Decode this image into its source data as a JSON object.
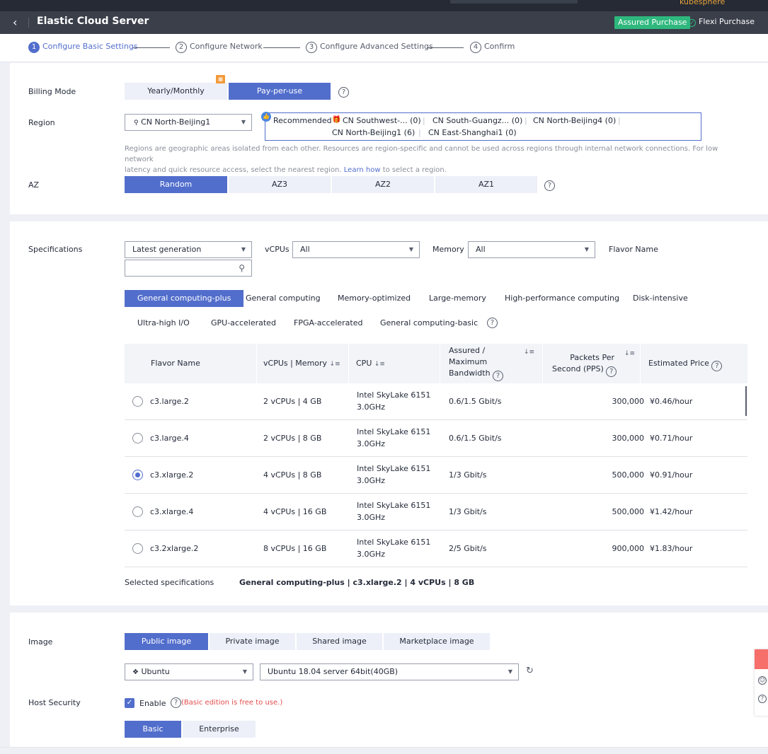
{
  "topbar": {
    "user": "kubesphere"
  },
  "header": {
    "back_icon": "chevron-left-icon",
    "title": "Elastic Cloud Server",
    "assured_purchase": "Assured Purchase",
    "flexi_purchase": "Flexi Purchase"
  },
  "steps": [
    {
      "num": "1",
      "label": "Configure Basic Settings"
    },
    {
      "num": "2",
      "label": "Configure Network"
    },
    {
      "num": "3",
      "label": "Configure Advanced Settings"
    },
    {
      "num": "4",
      "label": "Confirm"
    }
  ],
  "billing": {
    "label": "Billing Mode",
    "options": [
      "Yearly/Monthly",
      "Pay-per-use"
    ],
    "selected": "Pay-per-use",
    "help": "?"
  },
  "region": {
    "label": "Region",
    "selected": "CN North-Beijing1",
    "recommended_label": "Recommended",
    "recommended": [
      "CN Southwest-... (0)",
      "CN South-Guangz... (0)",
      "CN North-Beijing4 (0)",
      "CN North-Beijing1 (6)",
      "CN East-Shanghai1 (0)"
    ],
    "note_1": "Regions are geographic areas isolated from each other. Resources are region-specific and cannot be used across regions through internal network connections. For low network",
    "note_2a": "latency and quick resource access, select the nearest region.",
    "note_link": "Learn how",
    "note_2b": "to select a region."
  },
  "az": {
    "label": "AZ",
    "options": [
      "Random",
      "AZ3",
      "AZ2",
      "AZ1"
    ],
    "selected": "Random",
    "help": "?"
  },
  "specs": {
    "label": "Specifications",
    "generation": "Latest generation",
    "vcpus_label": "vCPUs",
    "vcpus_value": "All",
    "memory_label": "Memory",
    "memory_value": "All",
    "flavor_name_label": "Flavor Name",
    "flavor_search_value": "",
    "categories_row1": [
      "General computing-plus",
      "General computing",
      "Memory-optimized",
      "Large-memory",
      "High-performance computing",
      "Disk-intensive"
    ],
    "categories_row2": [
      "Ultra-high I/O",
      "GPU-accelerated",
      "FPGA-accelerated",
      "General computing-basic"
    ],
    "selected_category": "General computing-plus",
    "help": "?"
  },
  "table": {
    "headers": {
      "flavor": "Flavor Name",
      "vcpus_mem": "vCPUs | Memory",
      "cpu": "CPU",
      "bw_1": "Assured /",
      "bw_2": "Maximum",
      "bw_3": "Bandwidth",
      "pps_1": "Packets Per",
      "pps_2": "Second (PPS)",
      "price": "Estimated Price"
    },
    "sort_icon": "sort-icon",
    "rows": [
      {
        "flavor": "c3.large.2",
        "vcpus_mem": "2 vCPUs | 4 GB",
        "cpu_1": "Intel SkyLake 6151",
        "cpu_2": "3.0GHz",
        "bandwidth": "0.6/1.5 Gbit/s",
        "pps": "300,000",
        "price": "¥0.46/hour",
        "selected": false
      },
      {
        "flavor": "c3.large.4",
        "vcpus_mem": "2 vCPUs | 8 GB",
        "cpu_1": "Intel SkyLake 6151",
        "cpu_2": "3.0GHz",
        "bandwidth": "0.6/1.5 Gbit/s",
        "pps": "300,000",
        "price": "¥0.71/hour",
        "selected": false
      },
      {
        "flavor": "c3.xlarge.2",
        "vcpus_mem": "4 vCPUs | 8 GB",
        "cpu_1": "Intel SkyLake 6151",
        "cpu_2": "3.0GHz",
        "bandwidth": "1/3 Gbit/s",
        "pps": "500,000",
        "price": "¥0.91/hour",
        "selected": true
      },
      {
        "flavor": "c3.xlarge.4",
        "vcpus_mem": "4 vCPUs | 16 GB",
        "cpu_1": "Intel SkyLake 6151",
        "cpu_2": "3.0GHz",
        "bandwidth": "1/3 Gbit/s",
        "pps": "500,000",
        "price": "¥1.42/hour",
        "selected": false
      },
      {
        "flavor": "c3.2xlarge.2",
        "vcpus_mem": "8 vCPUs | 16 GB",
        "cpu_1": "Intel SkyLake 6151",
        "cpu_2": "3.0GHz",
        "bandwidth": "2/5 Gbit/s",
        "pps": "900,000",
        "price": "¥1.83/hour",
        "selected": false
      }
    ],
    "selected_label": "Selected specifications",
    "selected_value": "General computing-plus | c3.xlarge.2 | 4 vCPUs | 8 GB"
  },
  "image": {
    "label": "Image",
    "options": [
      "Public image",
      "Private image",
      "Shared image",
      "Marketplace image"
    ],
    "selected": "Public image",
    "os": "Ubuntu",
    "version": "Ubuntu 18.04 server 64bit(40GB)"
  },
  "host_security": {
    "label": "Host Security",
    "enable_label": "Enable",
    "note": "(Basic edition is free to use.)",
    "editions": [
      "Basic",
      "Enterprise"
    ],
    "selected": "Basic"
  },
  "colors": {
    "primary": "#526ecc",
    "header_bg": "#3a3f4a",
    "assured_green": "#2fb87e",
    "warning_red": "#e34c4c",
    "badge_orange": "#f29a3a"
  }
}
